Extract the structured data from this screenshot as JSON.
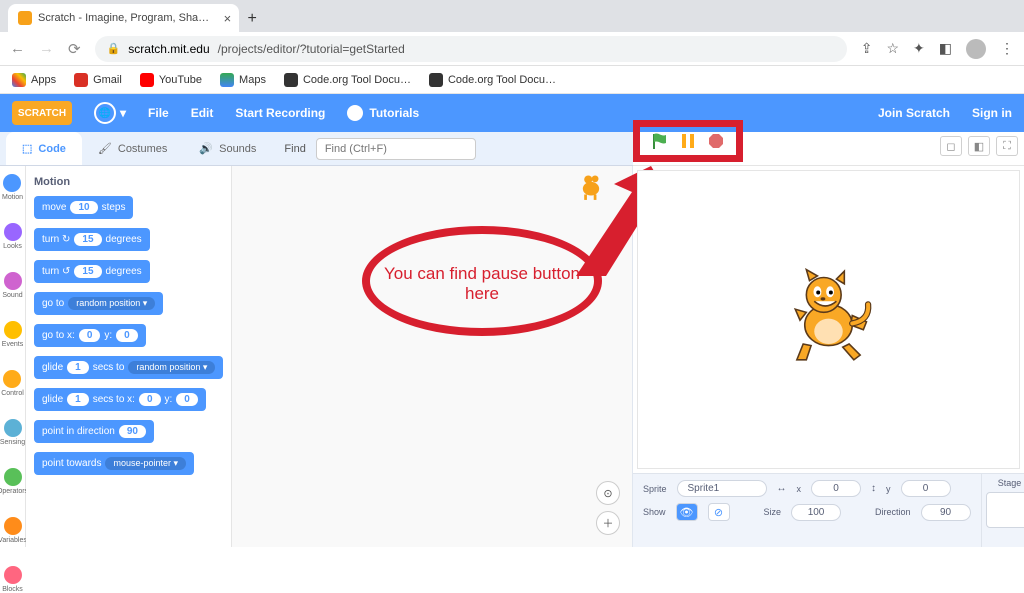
{
  "browser": {
    "tab_title": "Scratch - Imagine, Program, Sha…",
    "url_host": "scratch.mit.edu",
    "url_path": "/projects/editor/?tutorial=getStarted",
    "bookmarks": [
      {
        "label": "Apps",
        "color": "#666"
      },
      {
        "label": "Gmail",
        "color": "#d93025"
      },
      {
        "label": "YouTube",
        "color": "#ff0000"
      },
      {
        "label": "Maps",
        "color": "#34a853"
      },
      {
        "label": "Code.org Tool Docu…",
        "color": "#333"
      },
      {
        "label": "Code.org Tool Docu…",
        "color": "#333"
      }
    ]
  },
  "nav": {
    "logo": "SCRATCH",
    "file": "File",
    "edit": "Edit",
    "record": "Start Recording",
    "tutorials": "Tutorials",
    "join": "Join Scratch",
    "signin": "Sign in"
  },
  "tabs": {
    "code": "Code",
    "costumes": "Costumes",
    "sounds": "Sounds",
    "find_label": "Find",
    "find_placeholder": "Find (Ctrl+F)"
  },
  "categories": [
    {
      "name": "Motion",
      "short": "Motion",
      "color": "#4c97ff"
    },
    {
      "name": "Looks",
      "short": "Looks",
      "color": "#9966ff"
    },
    {
      "name": "Sound",
      "short": "Sound",
      "color": "#cf63cf"
    },
    {
      "name": "Events",
      "short": "Events",
      "color": "#ffbf00"
    },
    {
      "name": "Control",
      "short": "Control",
      "color": "#ffab19"
    },
    {
      "name": "Sensing",
      "short": "Sensing",
      "color": "#5cb1d6"
    },
    {
      "name": "Operators",
      "short": "Operators",
      "color": "#59c059"
    },
    {
      "name": "Variables",
      "short": "Variables",
      "color": "#ff8c1a"
    },
    {
      "name": "My Blocks",
      "short": "Blocks",
      "color": "#ff6680"
    }
  ],
  "palette_heading": "Motion",
  "blocks": {
    "move": {
      "pre": "move",
      "val": "10",
      "post": "steps"
    },
    "turn_r": {
      "pre": "turn ↻",
      "val": "15",
      "post": "degrees"
    },
    "turn_l": {
      "pre": "turn ↺",
      "val": "15",
      "post": "degrees"
    },
    "goto": {
      "pre": "go to",
      "dd": "random position ▾"
    },
    "gotoxy": {
      "pre": "go to x:",
      "x": "0",
      "mid": "y:",
      "y": "0"
    },
    "glide": {
      "pre": "glide",
      "s": "1",
      "mid": "secs to",
      "dd": "random position ▾"
    },
    "glidexy": {
      "pre": "glide",
      "s": "1",
      "mid1": "secs to x:",
      "x": "0",
      "mid2": "y:",
      "y": "0"
    },
    "point": {
      "pre": "point in direction",
      "val": "90"
    },
    "point2": {
      "pre": "point towards",
      "dd": "mouse-pointer ▾"
    }
  },
  "annotation": {
    "text": "You can find pause button here"
  },
  "sprite_info": {
    "sprite_label": "Sprite",
    "sprite_name": "Sprite1",
    "x_label": "x",
    "x": "0",
    "y_label": "y",
    "y": "0",
    "show_label": "Show",
    "size_label": "Size",
    "size": "100",
    "dir_label": "Direction",
    "dir": "90",
    "stage_label": "Stage"
  }
}
